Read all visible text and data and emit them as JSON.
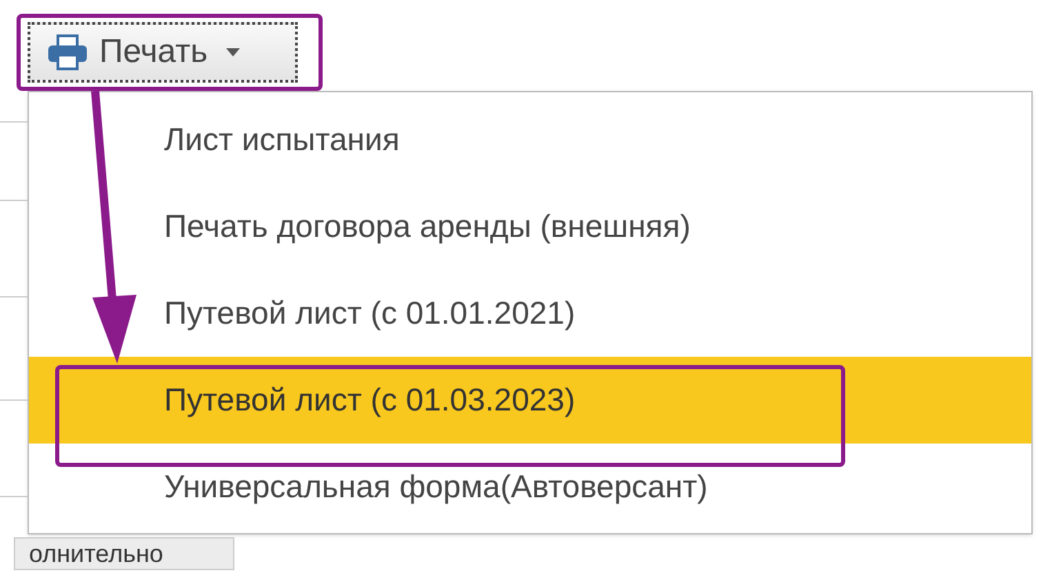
{
  "print_button": {
    "label": "Печать"
  },
  "menu": {
    "items": [
      {
        "label": "Лист испытания",
        "selected": false
      },
      {
        "label": "Печать договора аренды (внешняя)",
        "selected": false
      },
      {
        "label": "Путевой лист (с 01.01.2021)",
        "selected": false
      },
      {
        "label": "Путевой лист (с 01.03.2023)",
        "selected": true
      },
      {
        "label": "Универсальная форма(Автоверсант)",
        "selected": false
      }
    ]
  },
  "bottom_tab": {
    "label": "олнительно"
  }
}
